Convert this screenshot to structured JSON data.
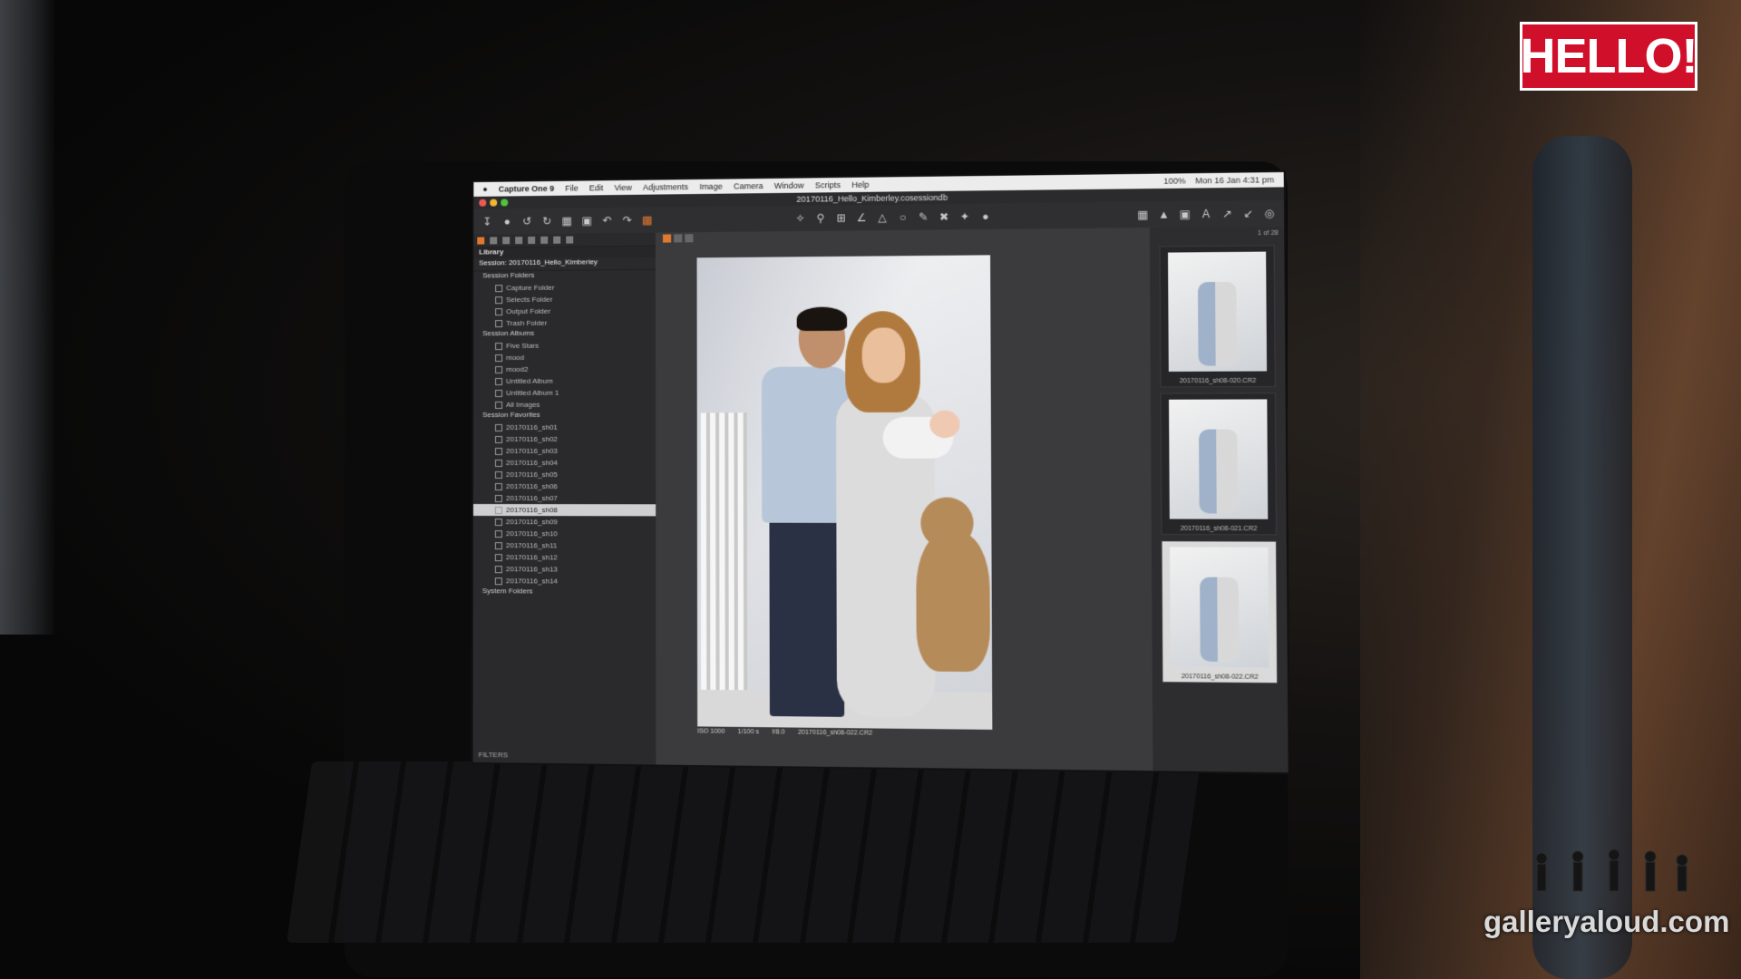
{
  "overlay": {
    "brand_logo": "HELLO!",
    "watermark": "galleryaloud.com"
  },
  "menubar": {
    "app_name": "Capture One 9",
    "menus": [
      "File",
      "Edit",
      "View",
      "Adjustments",
      "Image",
      "Camera",
      "Window",
      "Scripts",
      "Help"
    ],
    "clock": "Mon 16 Jan  4:31 pm",
    "battery": "100%"
  },
  "window": {
    "title": "20170116_Hello_Kimberley.cosessiondb"
  },
  "sidebar": {
    "library_label": "Library",
    "session_name": "Session: 20170116_Hello_Kimberley",
    "session_folders_label": "Session Folders",
    "session_folders": [
      "Capture Folder",
      "Selects Folder",
      "Output Folder",
      "Trash Folder"
    ],
    "session_albums_label": "Session Albums",
    "session_albums": [
      "Five Stars",
      "mood",
      "mood2",
      "Untitled Album",
      "Untitled Album 1",
      "All Images"
    ],
    "session_favorites_label": "Session Favorites",
    "session_favorites": [
      "20170116_sh01",
      "20170116_sh02",
      "20170116_sh03",
      "20170116_sh04",
      "20170116_sh05",
      "20170116_sh06",
      "20170116_sh07",
      "20170116_sh08",
      "20170116_sh09",
      "20170116_sh10",
      "20170116_sh11",
      "20170116_sh12",
      "20170116_sh13",
      "20170116_sh14"
    ],
    "selected_index": 7,
    "system_folders_label": "System Folders",
    "filters_label": "FILTERS"
  },
  "viewer": {
    "iso": "ISO 1000",
    "shutter": "1/100 s",
    "aperture": "f/8.0",
    "filename": "20170116_sh08-022.CR2"
  },
  "filmstrip": {
    "counter": "1 of 28",
    "thumbs": [
      {
        "caption": "20170116_sh08-020.CR2",
        "selected": false
      },
      {
        "caption": "20170116_sh08-021.CR2",
        "selected": false
      },
      {
        "caption": "20170116_sh08-022.CR2",
        "selected": true
      }
    ]
  },
  "colors": {
    "accent": "#e0782f",
    "brand": "#d0102a"
  }
}
